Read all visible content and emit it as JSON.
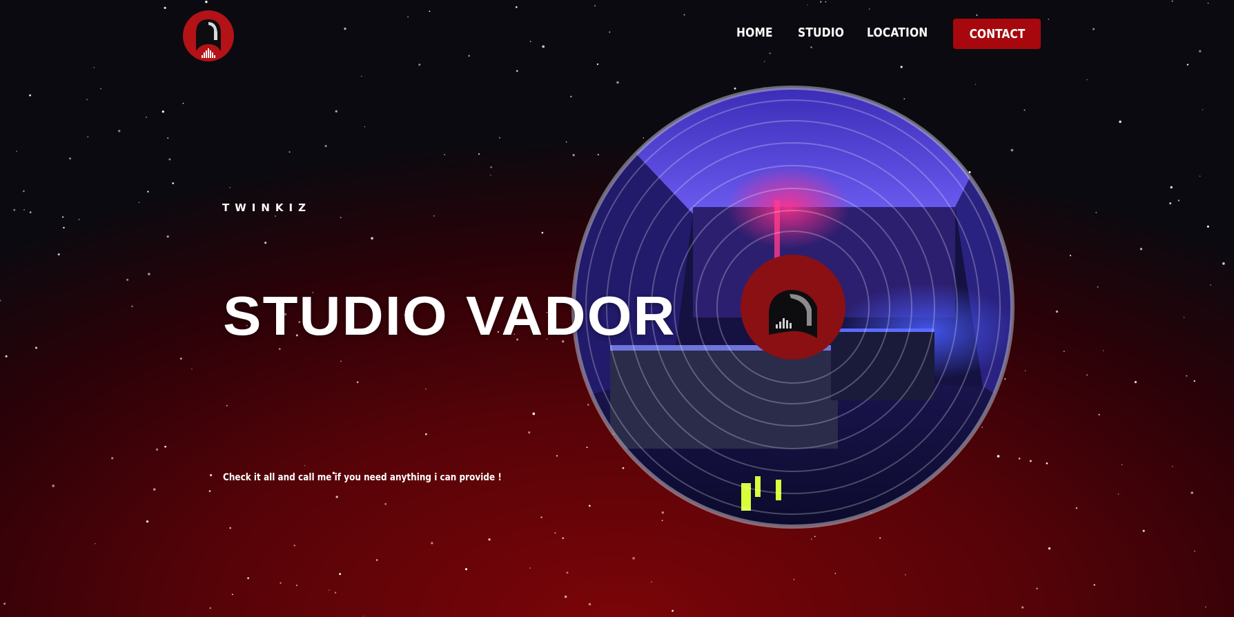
{
  "brand": {
    "logo_icon": "helmet-equalizer-logo",
    "accent_color": "#a6080d"
  },
  "nav": {
    "items": [
      {
        "label": "HOME"
      },
      {
        "label": "STUDIO"
      },
      {
        "label": "LOCATION"
      }
    ],
    "contact_label": "CONTACT"
  },
  "hero": {
    "eyebrow": "TWINKIZ",
    "title": "STUDIO VADOR",
    "tagline": "Check it all and call me if you need anything i can provide !"
  },
  "visual": {
    "record_icon": "vinyl-record-icon",
    "label_icon": "helmet-equalizer-logo",
    "background": "starfield"
  }
}
